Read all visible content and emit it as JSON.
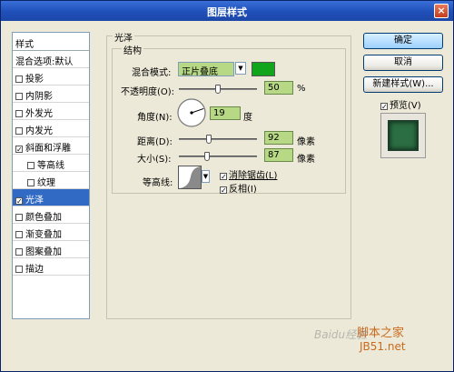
{
  "window": {
    "title": "图层样式",
    "close_glyph": "×"
  },
  "left_panel": {
    "header": "样式",
    "items": [
      {
        "label": "混合选项:默认",
        "checkbox": false,
        "checked": false,
        "sub": false,
        "selected": false
      },
      {
        "label": "投影",
        "checkbox": true,
        "checked": false,
        "sub": false,
        "selected": false
      },
      {
        "label": "内阴影",
        "checkbox": true,
        "checked": false,
        "sub": false,
        "selected": false
      },
      {
        "label": "外发光",
        "checkbox": true,
        "checked": false,
        "sub": false,
        "selected": false
      },
      {
        "label": "内发光",
        "checkbox": true,
        "checked": false,
        "sub": false,
        "selected": false
      },
      {
        "label": "斜面和浮雕",
        "checkbox": true,
        "checked": true,
        "sub": false,
        "selected": false
      },
      {
        "label": "等高线",
        "checkbox": true,
        "checked": false,
        "sub": true,
        "selected": false
      },
      {
        "label": "纹理",
        "checkbox": true,
        "checked": false,
        "sub": true,
        "selected": false
      },
      {
        "label": "光泽",
        "checkbox": true,
        "checked": true,
        "sub": false,
        "selected": true
      },
      {
        "label": "颜色叠加",
        "checkbox": true,
        "checked": false,
        "sub": false,
        "selected": false
      },
      {
        "label": "渐变叠加",
        "checkbox": true,
        "checked": false,
        "sub": false,
        "selected": false
      },
      {
        "label": "图案叠加",
        "checkbox": true,
        "checked": false,
        "sub": false,
        "selected": false
      },
      {
        "label": "描边",
        "checkbox": true,
        "checked": false,
        "sub": false,
        "selected": false
      }
    ]
  },
  "main": {
    "group_title": "光泽",
    "sub_title": "结构",
    "blend_mode_label": "混合模式:",
    "blend_mode_value": "正片叠底",
    "swatch_color": "#12a51c",
    "opacity_label": "不透明度(O):",
    "opacity_value": "50",
    "opacity_unit": "%",
    "opacity_level": 0.5,
    "angle_label": "角度(N):",
    "angle_value": "19",
    "angle_unit": "度",
    "distance_label": "距离(D):",
    "distance_value": "92",
    "distance_unit": "像素",
    "distance_level": 0.37,
    "size_label": "大小(S):",
    "size_value": "87",
    "size_unit": "像素",
    "size_level": 0.35,
    "contour_label": "等高线:",
    "anti_alias_label": "消除锯齿(L)",
    "anti_alias_checked": true,
    "invert_label": "反相(I)",
    "invert_checked": true
  },
  "buttons": {
    "ok": "确定",
    "cancel": "取消",
    "new_style": "新建样式(W)...",
    "preview": "预览(V)",
    "preview_checked": true
  },
  "watermark": {
    "line1": "Baidu经验",
    "line2": "脚本之家",
    "line3": "JB51.net"
  }
}
